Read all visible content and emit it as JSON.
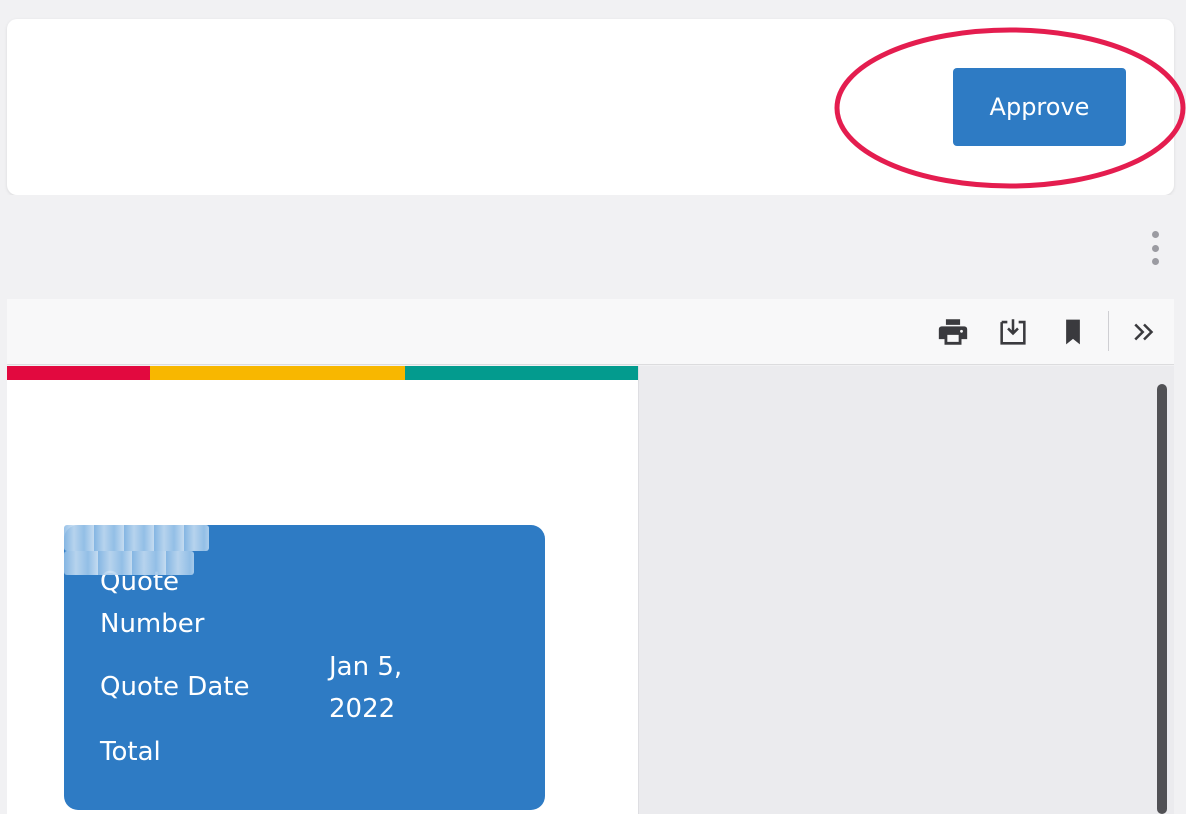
{
  "header": {
    "approve_label": "Approve"
  },
  "toolbar": {
    "icons": [
      "more-vertical-icon",
      "print-icon",
      "download-icon",
      "bookmark-icon",
      "double-chevron-right-icon"
    ]
  },
  "document": {
    "stripe_colors": [
      "#e2093f",
      "#f8b700",
      "#039b8e"
    ],
    "quote_card": {
      "quote_number_label": "Quote Number",
      "quote_date_label": "Quote Date",
      "quote_date_value": "Jan 5, 2022",
      "total_label": "Total"
    }
  },
  "colors": {
    "accent": "#2e7bc4",
    "highlight": "#e41d4f",
    "background": "#f1f1f3"
  }
}
